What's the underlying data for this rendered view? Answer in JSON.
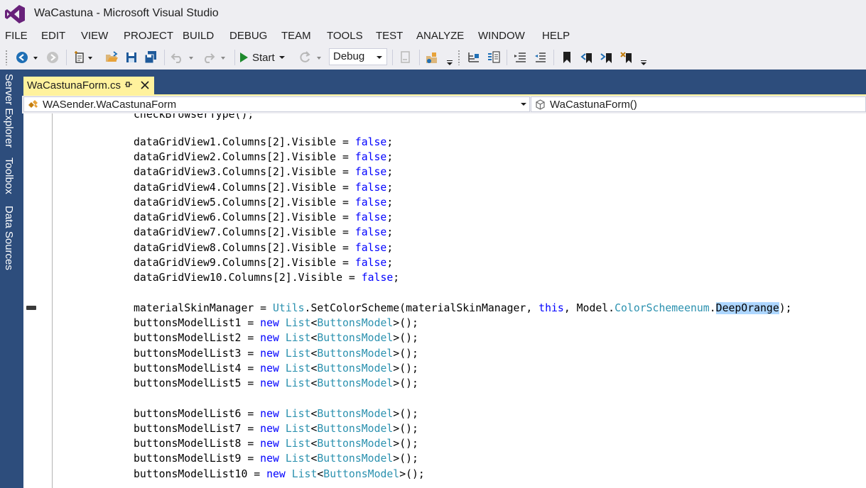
{
  "window": {
    "title": "WaCastuna - Microsoft Visual Studio"
  },
  "menu": {
    "items": [
      "FILE",
      "EDIT",
      "VIEW",
      "PROJECT",
      "BUILD",
      "DEBUG",
      "TEAM",
      "TOOLS",
      "TEST",
      "ANALYZE",
      "WINDOW",
      "HELP"
    ]
  },
  "toolbar": {
    "start_label": "Start",
    "config_value": "Debug"
  },
  "side_tabs": [
    "Server Explorer",
    "Toolbox",
    "Data Sources"
  ],
  "document_tab": {
    "label": "WaCastunaForm.cs"
  },
  "navigation": {
    "type_value": "WASender.WaCastunaForm",
    "member_value": "WaCastunaForm()"
  },
  "editor": {
    "partial_line": "checkBrowserType();",
    "lines": [
      {
        "pre": "dataGridView1.Columns[2].Visible = ",
        "kw": "false",
        "post": ";"
      },
      {
        "pre": "dataGridView2.Columns[2].Visible = ",
        "kw": "false",
        "post": ";"
      },
      {
        "pre": "dataGridView3.Columns[2].Visible = ",
        "kw": "false",
        "post": ";"
      },
      {
        "pre": "dataGridView4.Columns[2].Visible = ",
        "kw": "false",
        "post": ";"
      },
      {
        "pre": "dataGridView5.Columns[2].Visible = ",
        "kw": "false",
        "post": ";"
      },
      {
        "pre": "dataGridView6.Columns[2].Visible = ",
        "kw": "false",
        "post": ";"
      },
      {
        "pre": "dataGridView7.Columns[2].Visible = ",
        "kw": "false",
        "post": ";"
      },
      {
        "pre": "dataGridView8.Columns[2].Visible = ",
        "kw": "false",
        "post": ";"
      },
      {
        "pre": "dataGridView9.Columns[2].Visible = ",
        "kw": "false",
        "post": ";"
      },
      {
        "pre": "dataGridView10.Columns[2].Visible = ",
        "kw": "false",
        "post": ";"
      }
    ],
    "skin_line": {
      "a": "materialSkinManager = ",
      "t1": "Utils",
      "b": ".SetColorScheme(materialSkinManager, ",
      "kw": "this",
      "c": ", Model.",
      "t2": "ColorSchemeenum",
      "d": ".",
      "hl": "DeepOrange",
      "e": ");"
    },
    "list_lines_1": [
      {
        "name": "buttonsModelList1 = ",
        "kw": "new",
        "type1": "List",
        "lt": "<",
        "type2": "ButtonsModel",
        "end": ">();"
      },
      {
        "name": "buttonsModelList2 = ",
        "kw": "new",
        "type1": "List",
        "lt": "<",
        "type2": "ButtonsModel",
        "end": ">();"
      },
      {
        "name": "buttonsModelList3 = ",
        "kw": "new",
        "type1": "List",
        "lt": "<",
        "type2": "ButtonsModel",
        "end": ">();"
      },
      {
        "name": "buttonsModelList4 = ",
        "kw": "new",
        "type1": "List",
        "lt": "<",
        "type2": "ButtonsModel",
        "end": ">();"
      },
      {
        "name": "buttonsModelList5 = ",
        "kw": "new",
        "type1": "List",
        "lt": "<",
        "type2": "ButtonsModel",
        "end": ">();"
      }
    ],
    "list_lines_2": [
      {
        "name": "buttonsModelList6 = ",
        "kw": "new",
        "type1": "List",
        "lt": "<",
        "type2": "ButtonsModel",
        "end": ">();"
      },
      {
        "name": "buttonsModelList7 = ",
        "kw": "new",
        "type1": "List",
        "lt": "<",
        "type2": "ButtonsModel",
        "end": ">();"
      },
      {
        "name": "buttonsModelList8 = ",
        "kw": "new",
        "type1": "List",
        "lt": "<",
        "type2": "ButtonsModel",
        "end": ">();"
      },
      {
        "name": "buttonsModelList9 = ",
        "kw": "new",
        "type1": "List",
        "lt": "<",
        "type2": "ButtonsModel",
        "end": ">();"
      },
      {
        "name": "buttonsModelList10 = ",
        "kw": "new",
        "type1": "List",
        "lt": "<",
        "type2": "ButtonsModel",
        "end": ">();"
      }
    ]
  },
  "colors": {
    "keyword": "#0000ff",
    "type": "#2b91af",
    "selection": "#add6ff",
    "tab_active": "#fff29d",
    "frame": "#2d4d7c"
  }
}
